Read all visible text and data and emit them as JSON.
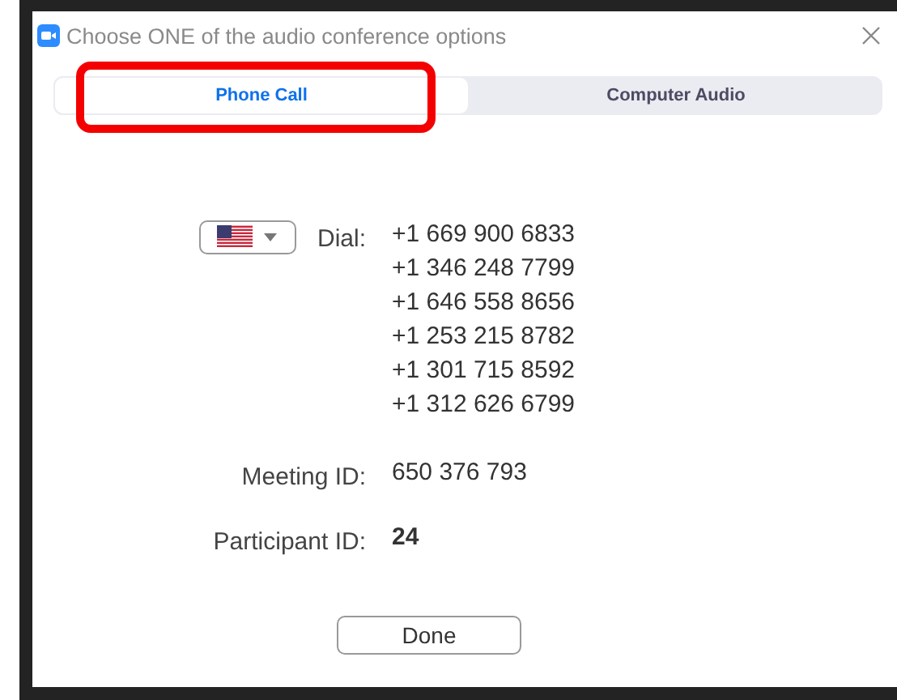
{
  "window": {
    "title": "Choose ONE of the audio conference options"
  },
  "tabs": [
    {
      "label": "Phone Call",
      "selected": true,
      "highlighted": true
    },
    {
      "label": "Computer Audio",
      "selected": false,
      "highlighted": false
    }
  ],
  "dial": {
    "label": "Dial:",
    "numbers": [
      "+1 669 900 6833",
      "+1 346 248 7799",
      "+1 646 558 8656",
      "+1 253 215 8782",
      "+1 301 715 8592",
      "+1 312 626 6799"
    ]
  },
  "fields": [
    {
      "label": "Meeting ID:",
      "value": "650 376 793",
      "emphasis": false
    },
    {
      "label": "Participant ID:",
      "value": "24",
      "emphasis": true
    }
  ],
  "buttons": [
    "Done"
  ]
}
